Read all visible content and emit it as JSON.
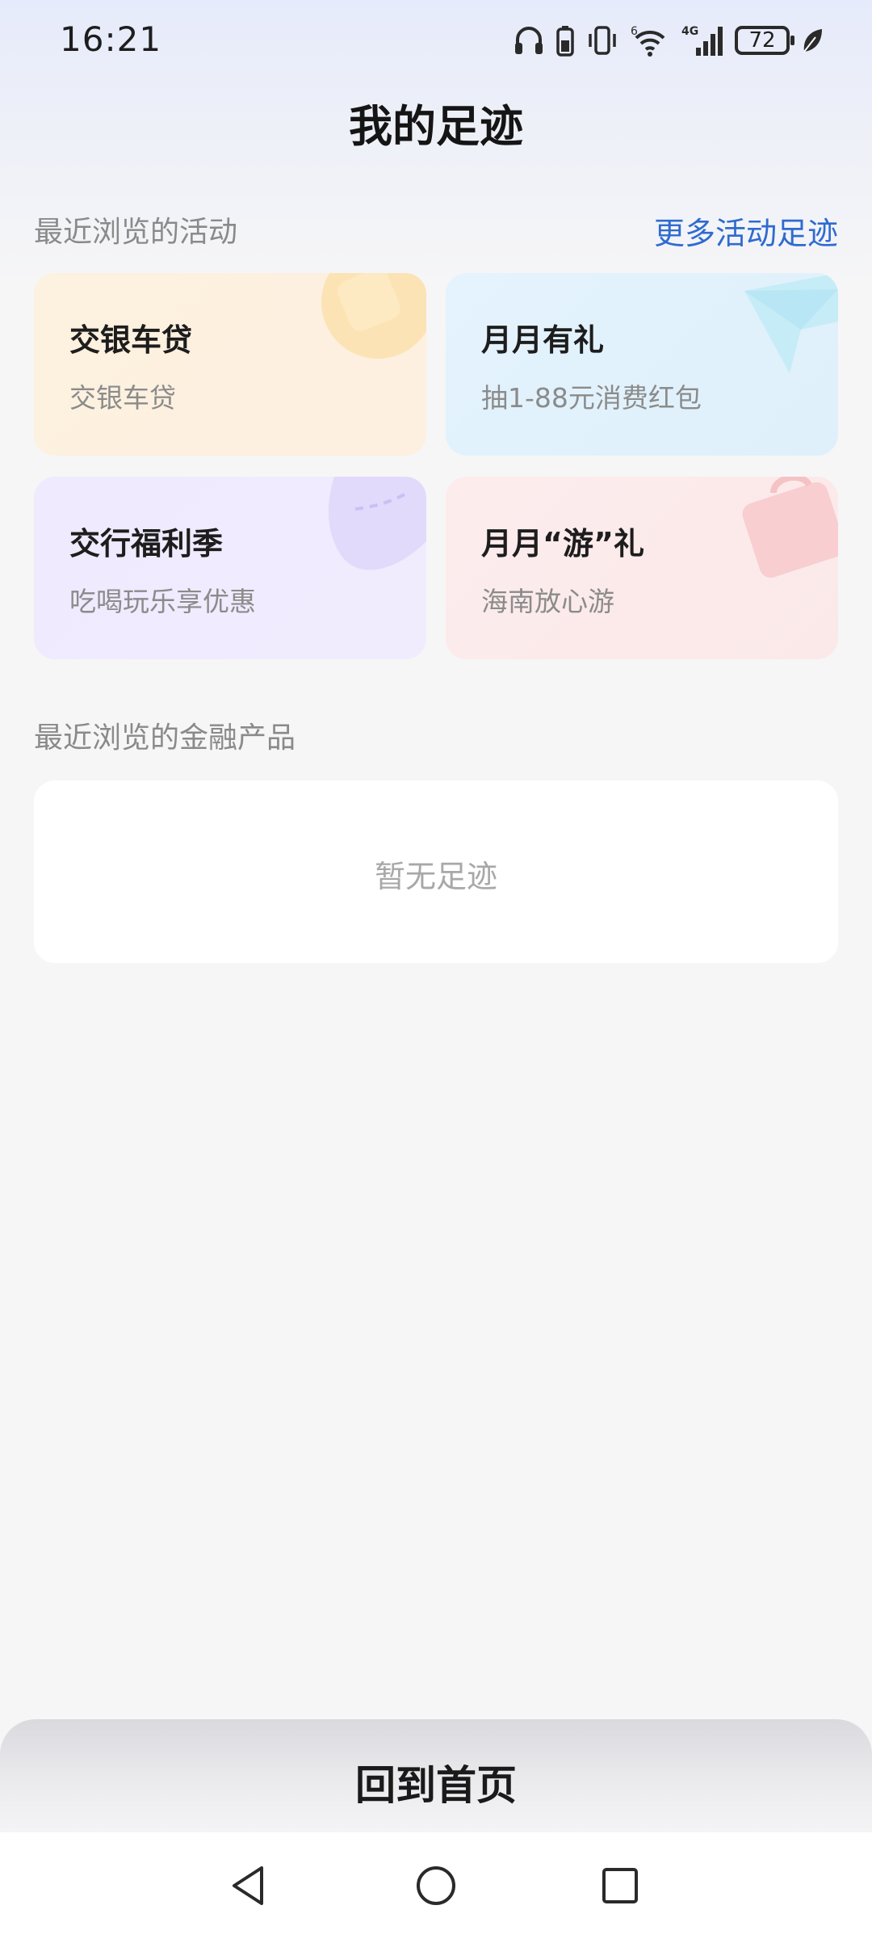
{
  "status_bar": {
    "time": "16:21",
    "battery": "72",
    "icons": [
      "headphones-icon",
      "phone-battery-icon",
      "vibrate-icon",
      "wifi-icon",
      "signal-4g-icon",
      "battery-icon",
      "leaf-icon"
    ],
    "network_label": "4G",
    "wifi_label": "6"
  },
  "header": {
    "title": "我的足迹"
  },
  "activities": {
    "section_title": "最近浏览的活动",
    "more_link": "更多活动足迹",
    "cards": [
      {
        "title": "交银车贷",
        "subtitle": "交银车贷",
        "color": "#fdf1df"
      },
      {
        "title": "月月有礼",
        "subtitle": "抽1-88元消费红包",
        "color": "#e4f3fd"
      },
      {
        "title": "交行福利季",
        "subtitle": "吃喝玩乐享优惠",
        "color": "#efeafe"
      },
      {
        "title": "月月“游”礼",
        "subtitle": "海南放心游",
        "color": "#fdecec"
      }
    ]
  },
  "products": {
    "section_title": "最近浏览的金融产品",
    "empty_text": "暂无足迹"
  },
  "footer": {
    "home_button": "回到首页"
  },
  "nav_bar": {
    "icons": [
      "back-icon",
      "home-icon",
      "recent-apps-icon"
    ]
  }
}
